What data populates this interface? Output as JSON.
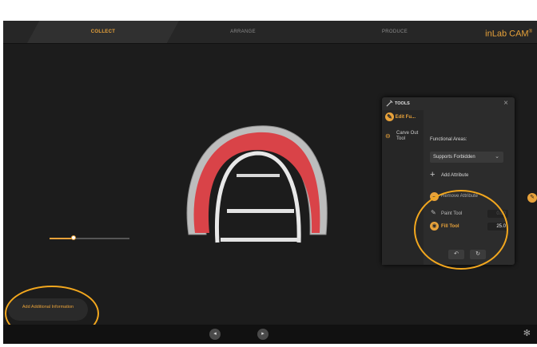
{
  "topbar": {
    "steps": [
      "COLLECT",
      "ARRANGE",
      "PRODUCE"
    ],
    "brand": "inLab CAM",
    "brand_mark": "®"
  },
  "tools_panel": {
    "title": "TOOLS",
    "sidebar": [
      {
        "label": "Edit Fu...",
        "icon": "edit-functional-icon"
      },
      {
        "label": "Carve Out Tool",
        "icon": "carve-out-icon"
      }
    ],
    "functional_areas_label": "Functional Areas:",
    "functional_areas_value": "Supports Forbidden",
    "add_attribute": "Add Attribute",
    "remove_attribute": "Remove Attribute",
    "paint_tool": {
      "label": "Paint Tool",
      "value": "0.00"
    },
    "fill_tool": {
      "label": "Fill Tool",
      "value": "25.0"
    },
    "slider_level": 0.3,
    "undo_icon": "undo-icon",
    "redo_icon": "redo-icon"
  },
  "add_info_button": "Add Additional Information",
  "colors": {
    "accent": "#e8a23a",
    "highlight_ring": "#f2a71e",
    "model_red": "#d94348",
    "background": "#1c1c1c"
  }
}
